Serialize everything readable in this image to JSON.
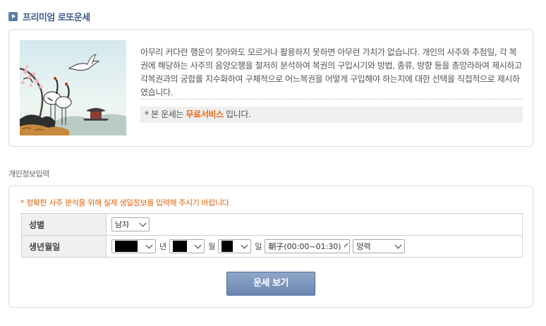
{
  "header": {
    "title": "프리미엄 로또운세"
  },
  "intro": {
    "description": "아무리 커다란 행운이 찾아와도 모르거나 활용하지 못하면 아무런 가치가 없습니다. 개인의 사주와 추첨일, 각 복권에 해당하는 사주의 음양오행을 철저히 분석하여 복권의 구입시기와 방법, 종류, 방향 등을 총망라하여 제시하고 각복권과의 궁합를 지수화하여 구체적으로 어느복권을 어떻게 구입해야 하는지에 대한 선택을 직접적으로 제시하였습니다.",
    "notice_prefix": "* 본 운세는",
    "notice_highlight": "무료서비스",
    "notice_suffix": "입니다."
  },
  "personal": {
    "section_label": "개인정보입력",
    "warning": "* 정확한 사주 분석을 위해 실제 생일정보를 입력해 주시기 바랍니다.",
    "gender_label": "성별",
    "gender_value": "남자",
    "birth_label": "생년월일",
    "year_unit": "년",
    "month_unit": "월",
    "day_unit": "일",
    "time_value": "朝子(00:00~01:30)",
    "calendar_value": "양력",
    "submit_label": "운세 보기"
  },
  "colors": {
    "accent": "#3d5f8a",
    "highlight": "#e66a14",
    "warning": "#e0620c",
    "button": "#7891b9"
  }
}
